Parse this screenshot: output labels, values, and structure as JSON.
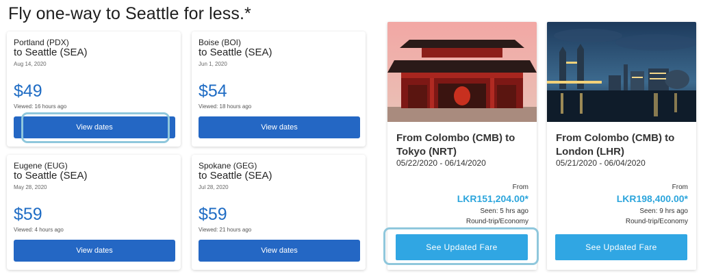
{
  "page_title": "Fly one-way to Seattle for less.*",
  "deals": [
    {
      "origin": "Portland (PDX)",
      "destination": "to Seattle (SEA)",
      "date": "Aug 14, 2020",
      "price": "$49",
      "viewed": "Viewed: 16 hours ago",
      "button_label": "View dates"
    },
    {
      "origin": "Boise (BOI)",
      "destination": "to Seattle (SEA)",
      "date": "Jun 1, 2020",
      "price": "$54",
      "viewed": "Viewed: 18 hours ago",
      "button_label": "View dates"
    },
    {
      "origin": "Eugene (EUG)",
      "destination": "to Seattle (SEA)",
      "date": "May 28, 2020",
      "price": "$59",
      "viewed": "Viewed: 4 hours ago",
      "button_label": "View dates"
    },
    {
      "origin": "Spokane (GEG)",
      "destination": "to Seattle (SEA)",
      "date": "Jul 28, 2020",
      "price": "$59",
      "viewed": "Viewed: 21 hours ago",
      "button_label": "View dates"
    }
  ],
  "fares": [
    {
      "route": "From Colombo (CMB) to Tokyo (NRT)",
      "dates": "05/22/2020 - 06/14/2020",
      "from_label": "From",
      "price": "LKR151,204.00*",
      "seen": "Seen: 5 hrs ago",
      "trip_type": "Round-trip/Economy",
      "button_label": "See Updated Fare",
      "image_icon": "tokyo-temple-photo"
    },
    {
      "route": "From Colombo (CMB) to London (LHR)",
      "dates": "05/21/2020 - 06/04/2020",
      "from_label": "From",
      "price": "LKR198,400.00*",
      "seen": "Seen: 9 hrs ago",
      "trip_type": "Round-trip/Economy",
      "button_label": "See Updated Fare",
      "image_icon": "london-skyline-photo"
    }
  ],
  "colors": {
    "deal_price": "#1f6cc4",
    "deal_button": "#2467c4",
    "fare_price": "#2ca5dc",
    "fare_button": "#30a6e3",
    "highlight": "#8fc7dc"
  }
}
